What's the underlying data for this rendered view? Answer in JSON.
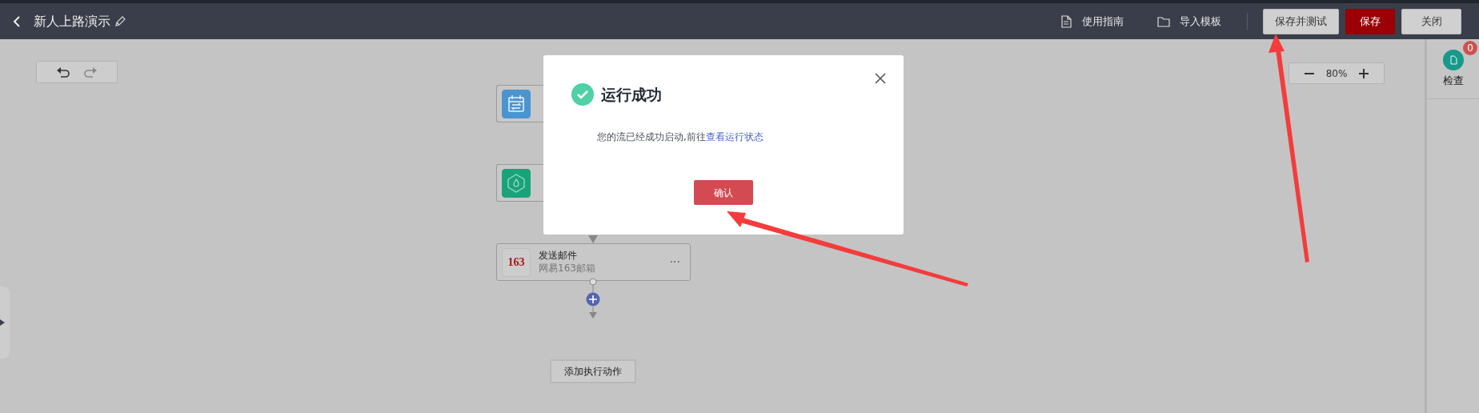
{
  "header": {
    "title": "新人上路演示",
    "links": [
      {
        "kind": "guide",
        "label": "使用指南"
      },
      {
        "kind": "import",
        "label": "导入模板"
      }
    ],
    "buttons": [
      {
        "label": "保存并测试",
        "kind": "default"
      },
      {
        "label": "保存",
        "kind": "primary"
      },
      {
        "label": "关闭",
        "kind": "default"
      }
    ]
  },
  "canvas": {
    "zoom": "80%",
    "nodes": [
      {
        "kind": "schedule"
      },
      {
        "kind": "hot"
      },
      {
        "kind": "mail163",
        "title": "发送邮件",
        "subtitle": "网易163邮箱",
        "logo": "163",
        "menu": "···"
      }
    ],
    "add_action": "添加执行动作"
  },
  "side_panel": {
    "label": "检查",
    "badge": "0"
  },
  "dialog": {
    "title": "运行成功",
    "message": "您的流已经成功启动,前往",
    "link": "查看运行状态",
    "confirm": "确认"
  }
}
